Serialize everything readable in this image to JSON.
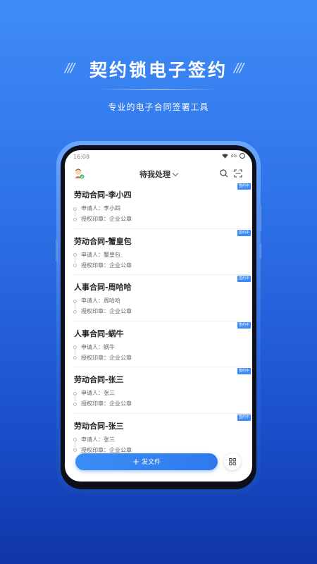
{
  "hero": {
    "title": "契约锁电子签约",
    "slashes": "///",
    "subtitle": "专业的电子合同签署工具"
  },
  "statusbar": {
    "time": "16:08",
    "signal_text": "4G"
  },
  "appbar": {
    "filter_label": "待我处理"
  },
  "labels": {
    "applicant": "申请人：",
    "seal": "授权印章："
  },
  "contracts": [
    {
      "title": "劳动合同-李小四",
      "applicant": "李小四",
      "seal": "企业公章",
      "status": "签约中"
    },
    {
      "title": "劳动合同-蟹皇包",
      "applicant": "蟹皇包",
      "seal": "企业公章",
      "status": "签约中"
    },
    {
      "title": "人事合同-周哈哈",
      "applicant": "周哈哈",
      "seal": "企业公章",
      "status": "签约中"
    },
    {
      "title": "人事合同-蜗牛",
      "applicant": "蜗牛",
      "seal": "企业公章",
      "status": "签约中"
    },
    {
      "title": "劳动合同-张三",
      "applicant": "张三",
      "seal": "企业公章",
      "status": "签约中"
    },
    {
      "title": "劳动合同-张三",
      "applicant": "张三",
      "seal": "企业公章",
      "status": "签约中"
    }
  ],
  "actions": {
    "send_label": "发文件"
  },
  "icons": {
    "avatar": "avatar-icon",
    "search": "search-icon",
    "scan": "scan-icon",
    "grid": "grid-icon",
    "plus": "plus-icon"
  },
  "colors": {
    "primary": "#3c8bf6",
    "background_top": "#3f8cf7",
    "background_bottom": "#0f36a8"
  }
}
